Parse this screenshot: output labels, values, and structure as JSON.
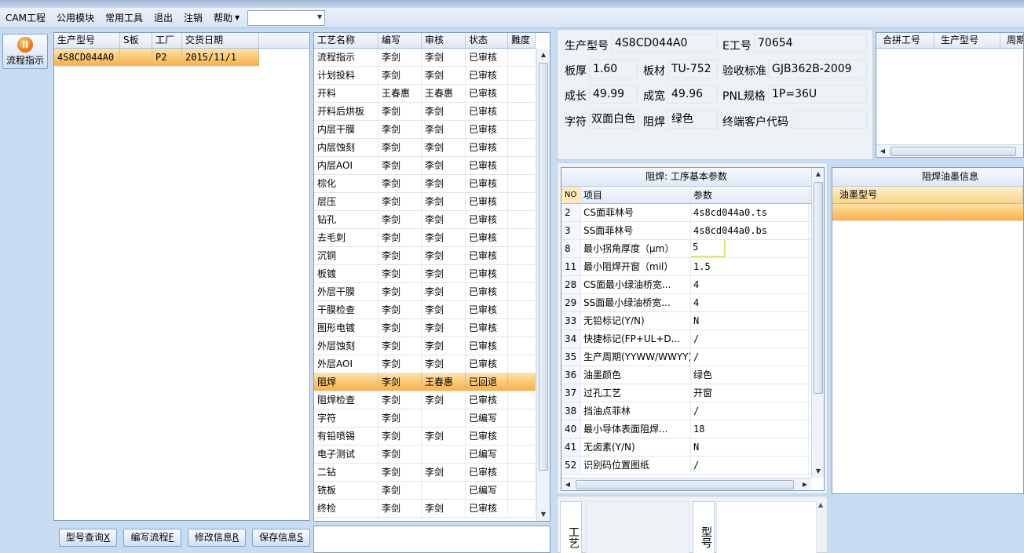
{
  "menubar": {
    "items": [
      "CAM工程",
      "公用模块",
      "常用工具",
      "退出",
      "注销",
      "帮助"
    ],
    "combo_value": ""
  },
  "leftbar": {
    "flow_button_label": "流程指示"
  },
  "orders_grid": {
    "columns": [
      "生产型号",
      "S板",
      "工厂",
      "交货日期"
    ],
    "rows": [
      {
        "model": "4S8CD044A0",
        "s_board": "",
        "factory": "P2",
        "delivery": "2015/11/1",
        "selected": true
      }
    ]
  },
  "buttons": {
    "query": {
      "label": "型号查询",
      "key": "X"
    },
    "edit_flow": {
      "label": "编写流程",
      "key": "F"
    },
    "modify": {
      "label": "修改信息",
      "key": "R"
    },
    "save": {
      "label": "保存信息",
      "key": "S"
    }
  },
  "process_grid": {
    "columns": [
      "工艺名称",
      "编写",
      "审核",
      "状态",
      "難度"
    ],
    "rows": [
      {
        "name": "流程指示",
        "author": "李剑",
        "reviewer": "李剑",
        "status": "已审核"
      },
      {
        "name": "计划投料",
        "author": "李剑",
        "reviewer": "李剑",
        "status": "已审核"
      },
      {
        "name": "开料",
        "author": "王春惠",
        "reviewer": "王春惠",
        "status": "已审核"
      },
      {
        "name": "开料后烘板",
        "author": "李剑",
        "reviewer": "李剑",
        "status": "已审核"
      },
      {
        "name": "内层干膜",
        "author": "李剑",
        "reviewer": "李剑",
        "status": "已审核"
      },
      {
        "name": "内层蚀刻",
        "author": "李剑",
        "reviewer": "李剑",
        "status": "已审核"
      },
      {
        "name": "内层AOI",
        "author": "李剑",
        "reviewer": "李剑",
        "status": "已审核"
      },
      {
        "name": "棕化",
        "author": "李剑",
        "reviewer": "李剑",
        "status": "已审核"
      },
      {
        "name": "层压",
        "author": "李剑",
        "reviewer": "李剑",
        "status": "已审核"
      },
      {
        "name": "钻孔",
        "author": "李剑",
        "reviewer": "李剑",
        "status": "已审核"
      },
      {
        "name": "去毛刺",
        "author": "李剑",
        "reviewer": "李剑",
        "status": "已审核"
      },
      {
        "name": "沉铜",
        "author": "李剑",
        "reviewer": "李剑",
        "status": "已审核"
      },
      {
        "name": "板镀",
        "author": "李剑",
        "reviewer": "李剑",
        "status": "已审核"
      },
      {
        "name": "外层干膜",
        "author": "李剑",
        "reviewer": "李剑",
        "status": "已审核"
      },
      {
        "name": "干膜检查",
        "author": "李剑",
        "reviewer": "李剑",
        "status": "已审核"
      },
      {
        "name": "图形电镀",
        "author": "李剑",
        "reviewer": "李剑",
        "status": "已审核"
      },
      {
        "name": "外层蚀刻",
        "author": "李剑",
        "reviewer": "李剑",
        "status": "已审核"
      },
      {
        "name": "外层AOI",
        "author": "李剑",
        "reviewer": "李剑",
        "status": "已审核"
      },
      {
        "name": "阻焊",
        "author": "李剑",
        "reviewer": "王春惠",
        "status": "已回退",
        "selected": true
      },
      {
        "name": "阻焊检查",
        "author": "李剑",
        "reviewer": "李剑",
        "status": "已审核"
      },
      {
        "name": "字符",
        "author": "李剑",
        "reviewer": "",
        "status": "已编写"
      },
      {
        "name": "有铅喷锡",
        "author": "李剑",
        "reviewer": "李剑",
        "status": "已审核"
      },
      {
        "name": "电子测试",
        "author": "李剑",
        "reviewer": "",
        "status": "已编写"
      },
      {
        "name": "二钻",
        "author": "李剑",
        "reviewer": "李剑",
        "status": "已审核"
      },
      {
        "name": "铣板",
        "author": "李剑",
        "reviewer": "",
        "status": "已编写"
      },
      {
        "name": "终检",
        "author": "李剑",
        "reviewer": "李剑",
        "status": "已审核"
      }
    ]
  },
  "info": {
    "model_label": "生产型号",
    "model_value": "4S8CD044A0",
    "eno_label": "E工号",
    "eno_value": "70654",
    "thickness_label": "板厚",
    "thickness_value": "1.60",
    "material_label": "板材",
    "material_value": "TU-752",
    "standard_label": "验收标准",
    "standard_value": "GJB362B-2009",
    "length_label": "成长",
    "length_value": "49.99",
    "width_label": "成宽",
    "width_value": "49.96",
    "pnl_label": "PNL规格",
    "pnl_value": "1P=36U",
    "char_label": "字符",
    "char_value": "双面白色",
    "mask_label": "阻焊",
    "mask_value": "绿色",
    "customer_label": "终端客户代码",
    "customer_value": ""
  },
  "merge_grid": {
    "columns": [
      "合拼工号",
      "生产型号",
      "周期"
    ]
  },
  "params": {
    "title": "阻焊: 工序基本参数",
    "columns": [
      "NO",
      "项目",
      "参数"
    ],
    "rows": [
      {
        "no": "2",
        "item": "CS面菲林号",
        "value": "4s8cd044a0.ts"
      },
      {
        "no": "3",
        "item": "SS面菲林号",
        "value": "4s8cd044a0.bs"
      },
      {
        "no": "8",
        "item": "最小拐角厚度（μm）",
        "value": "5",
        "editing": true
      },
      {
        "no": "11",
        "item": "最小阻焊开窗（mil）",
        "value": "1.5"
      },
      {
        "no": "28",
        "item": "CS面最小绿油桥宽...",
        "value": "4"
      },
      {
        "no": "29",
        "item": "SS面最小绿油桥宽...",
        "value": "4"
      },
      {
        "no": "33",
        "item": "无铅标记(Y/N)",
        "value": "N"
      },
      {
        "no": "34",
        "item": "快捷标记(FP+UL+D...",
        "value": "/"
      },
      {
        "no": "35",
        "item": "生产周期(YYWW/WWYY)",
        "value": "/"
      },
      {
        "no": "36",
        "item": "油墨颜色",
        "value": "绿色"
      },
      {
        "no": "37",
        "item": "过孔工艺",
        "value": "开窗"
      },
      {
        "no": "38",
        "item": "挡油点菲林",
        "value": "/"
      },
      {
        "no": "40",
        "item": "最小导体表面阻焊...",
        "value": "18"
      },
      {
        "no": "41",
        "item": "无卤素(Y/N)",
        "value": "N"
      },
      {
        "no": "52",
        "item": "识别码位置图纸",
        "value": "/"
      }
    ]
  },
  "ink": {
    "title": "阻焊油墨信息",
    "column": "油墨型号"
  },
  "bottom_panel": {
    "craft_label": "工艺",
    "model_label": "型号"
  }
}
